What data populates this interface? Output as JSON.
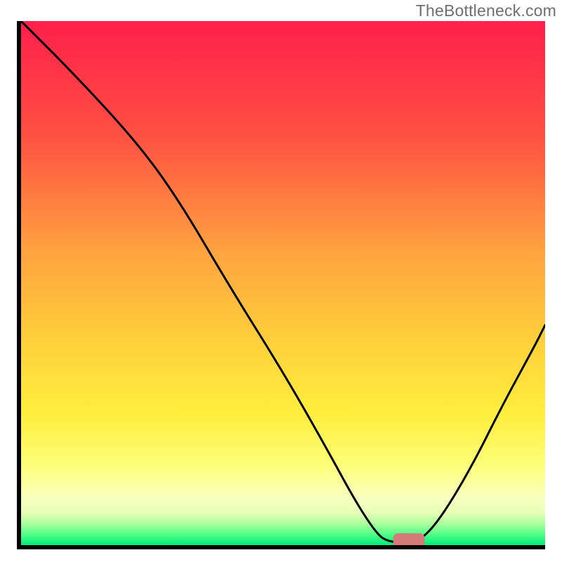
{
  "watermark": "TheBottleneck.com",
  "chart_data": {
    "type": "line",
    "title": "",
    "xlabel": "",
    "ylabel": "",
    "x_range": [
      0,
      100
    ],
    "y_range": [
      0,
      100
    ],
    "gradient_stops": [
      {
        "offset": 0,
        "color": "#ff1f4b"
      },
      {
        "offset": 22,
        "color": "#ff5142"
      },
      {
        "offset": 45,
        "color": "#ffa63f"
      },
      {
        "offset": 62,
        "color": "#ffd23a"
      },
      {
        "offset": 75,
        "color": "#ffee3d"
      },
      {
        "offset": 85,
        "color": "#fdff7a"
      },
      {
        "offset": 91,
        "color": "#f8ffc0"
      },
      {
        "offset": 94,
        "color": "#e5ffb5"
      },
      {
        "offset": 96,
        "color": "#a6ff9c"
      },
      {
        "offset": 98,
        "color": "#4fff86"
      },
      {
        "offset": 100,
        "color": "#00e87a"
      }
    ],
    "series": [
      {
        "name": "bottleneck-curve",
        "color": "#000000",
        "stroke_width": 3,
        "points": [
          {
            "x": 0,
            "y": 100
          },
          {
            "x": 10,
            "y": 90
          },
          {
            "x": 22,
            "y": 77
          },
          {
            "x": 30,
            "y": 66
          },
          {
            "x": 40,
            "y": 49
          },
          {
            "x": 50,
            "y": 33
          },
          {
            "x": 58,
            "y": 19
          },
          {
            "x": 64,
            "y": 8
          },
          {
            "x": 68,
            "y": 2
          },
          {
            "x": 70,
            "y": 0.7
          },
          {
            "x": 73,
            "y": 0.5
          },
          {
            "x": 76,
            "y": 0.7
          },
          {
            "x": 80,
            "y": 5
          },
          {
            "x": 86,
            "y": 15
          },
          {
            "x": 92,
            "y": 27
          },
          {
            "x": 98,
            "y": 38
          },
          {
            "x": 100,
            "y": 42
          }
        ]
      }
    ],
    "marker": {
      "name": "target-marker",
      "color": "#d47a78",
      "x_start": 71,
      "x_end": 77,
      "y": 0.6,
      "thickness": 2.0
    }
  }
}
